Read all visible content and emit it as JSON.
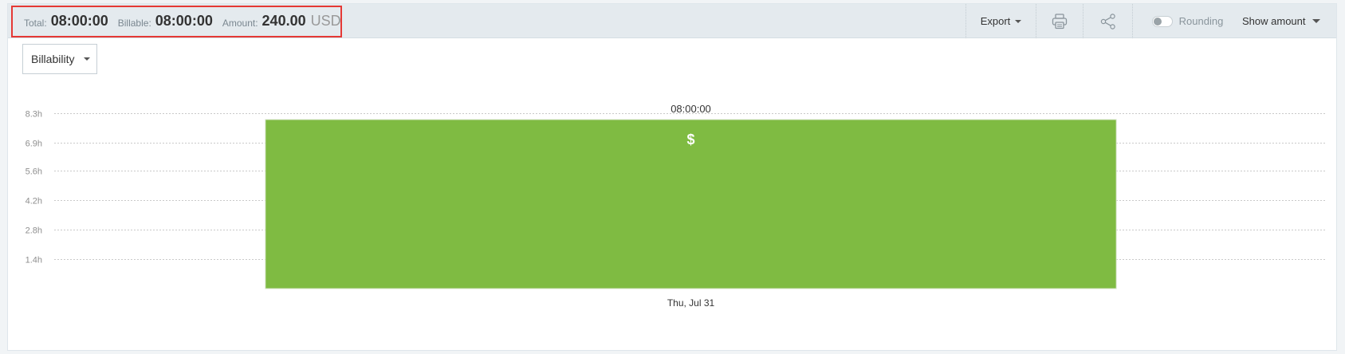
{
  "summary": {
    "total_label": "Total:",
    "total_value": "08:00:00",
    "billable_label": "Billable:",
    "billable_value": "08:00:00",
    "amount_label": "Amount:",
    "amount_value": "240.00",
    "amount_currency": "USD"
  },
  "toolbar": {
    "export_label": "Export",
    "print_icon": "printer-icon",
    "share_icon": "share-icon",
    "rounding_label": "Rounding",
    "rounding_on": false,
    "show_amount_label": "Show amount"
  },
  "group_by": {
    "selected": "Billability"
  },
  "colors": {
    "bar_billable": "#7fbb42",
    "highlight": "#e53935",
    "header_bg": "#e4eaee"
  },
  "chart_data": {
    "type": "bar",
    "categories": [
      "Thu, Jul 31"
    ],
    "series": [
      {
        "values": [
          8.0
        ],
        "data_labels": [
          "08:00:00"
        ],
        "icon": "$"
      }
    ],
    "yticks": [
      1.4,
      2.8,
      4.2,
      5.6,
      6.9,
      8.3
    ],
    "ytick_labels": [
      "1.4h",
      "2.8h",
      "4.2h",
      "5.6h",
      "6.9h",
      "8.3h"
    ],
    "ylim": [
      0,
      8.3
    ],
    "unit": "h",
    "grid": true,
    "xlabel": "",
    "ylabel": ""
  }
}
